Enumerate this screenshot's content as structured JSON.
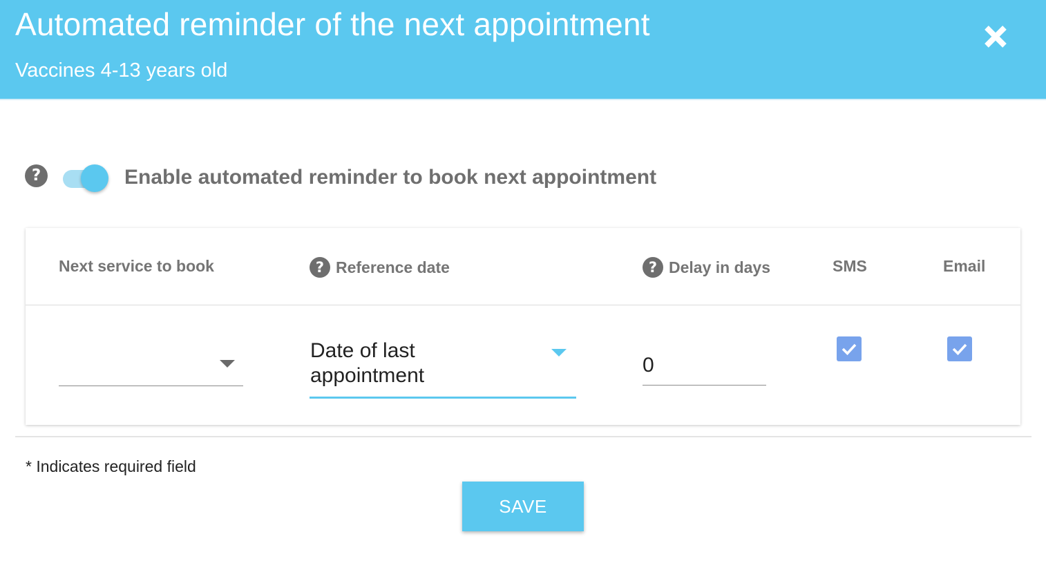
{
  "header": {
    "title": "Automated reminder of the next appointment",
    "subtitle": "Vaccines 4-13 years old",
    "close_icon": "close-icon"
  },
  "toggle": {
    "label": "Enable automated reminder to book next appointment",
    "enabled": true,
    "help_icon": "question-circle-icon"
  },
  "table": {
    "columns": {
      "service": "Next service to book",
      "reference": "Reference date",
      "delay": "Delay in days",
      "sms": "SMS",
      "email": "Email"
    },
    "row": {
      "service_value": "",
      "reference_value": "Date of last appointment",
      "delay_value": "0",
      "sms_checked": true,
      "email_checked": true
    }
  },
  "footer": {
    "required_note": "* Indicates required field",
    "save_label": "SAVE"
  },
  "colors": {
    "accent": "#5bc8ef",
    "checkbox": "#78a3ec",
    "text_muted": "#757575"
  }
}
